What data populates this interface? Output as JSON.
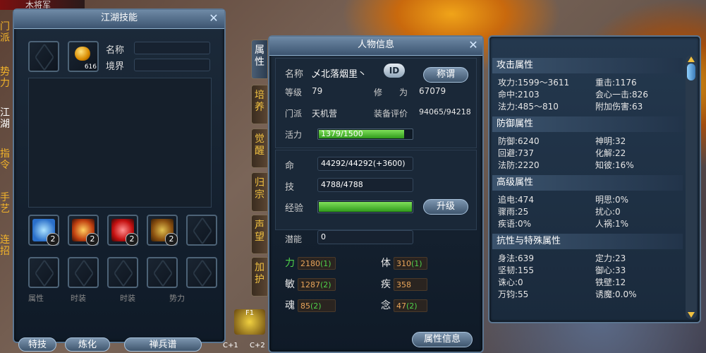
{
  "top_left_name": "木将军",
  "left_tabs": [
    "门派",
    "势力",
    "江湖",
    "指令",
    "手艺",
    "连招"
  ],
  "skills_panel": {
    "title": "江湖技能",
    "name_label": "名称",
    "realm_label": "境界",
    "gold_item_count": "616",
    "skill_badges": [
      "2",
      "2",
      "2",
      "2"
    ],
    "bottom_buttons": [
      "特技",
      "炼化",
      "禅兵谱"
    ],
    "bottom_checkboxes": [
      "属性",
      "时装",
      "时装",
      "势力"
    ]
  },
  "vertical_tabs": [
    "属性",
    "培养",
    "觉醒",
    "归宗",
    "声望",
    "加护"
  ],
  "char_panel": {
    "title": "人物信息",
    "name_label": "名称",
    "name_value": "乄北落烟里丶",
    "id_button": "ID",
    "title_button": "称谓",
    "level_label": "等级",
    "level_value": "79",
    "cultivation_label": "修　　为",
    "cultivation_value": "67079",
    "sect_label": "门派",
    "sect_value": "天机营",
    "equip_label": "装备评价",
    "equip_value": "94065/94218",
    "vitality_label": "活力",
    "vitality_value": "1379/1500",
    "vitality_fraction": 0.919,
    "life_label": "命",
    "life_value": "44292/44292(+3600)",
    "skill_label": "技",
    "skill_value": "4788/4788",
    "exp_label": "经验",
    "exp_fraction": 1.0,
    "upgrade_button": "升级",
    "potential_label": "潜能",
    "potential_value": "0",
    "attrs": [
      {
        "name": "力",
        "value": "2180",
        "bonus": "(1)",
        "color": "#4fd24a"
      },
      {
        "name": "体",
        "value": "310",
        "bonus": "(1)",
        "color": "#ffffff"
      },
      {
        "name": "敏",
        "value": "1287",
        "bonus": "(2)",
        "color": "#ffffff"
      },
      {
        "name": "疾",
        "value": "358",
        "bonus": "",
        "color": "#ffffff"
      },
      {
        "name": "魂",
        "value": "85",
        "bonus": "(2)",
        "color": "#ffffff"
      },
      {
        "name": "念",
        "value": "47",
        "bonus": "(2)",
        "color": "#ffffff"
      }
    ],
    "attr_info_button": "属性信息"
  },
  "stats_panel": {
    "sections": [
      {
        "title": "攻击属性",
        "rows": [
          [
            "攻力:1599～3611",
            "重击:1176"
          ],
          [
            "命中:2103",
            "会心一击:826"
          ],
          [
            "法力:485～810",
            "附加伤害:63"
          ]
        ]
      },
      {
        "title": "防御属性",
        "rows": [
          [
            "防御:6240",
            "神明:32"
          ],
          [
            "回避:737",
            "化解:22"
          ],
          [
            "法防:2220",
            "知彼:16%"
          ]
        ]
      },
      {
        "title": "高级属性",
        "rows": [
          [
            "追电:474",
            "明思:0%"
          ],
          [
            "骤雨:25",
            "扰心:0"
          ],
          [
            "疾语:0%",
            "人祸:1%"
          ]
        ]
      },
      {
        "title": "抗性与特殊属性",
        "rows": [
          [
            "身法:639",
            "定力:23"
          ],
          [
            "坚韧:155",
            "御心:33"
          ],
          [
            "诛心:0",
            "铁壁:12"
          ],
          [
            "万钧:55",
            "诱魔:0.0%"
          ]
        ]
      }
    ]
  },
  "bottom_hotkeys": [
    "F1",
    "C+1",
    "C+2"
  ]
}
